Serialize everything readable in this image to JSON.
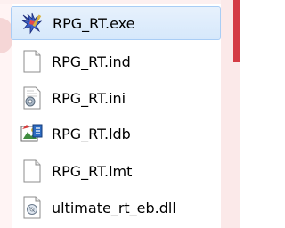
{
  "files": [
    {
      "name": "RPG_RT.exe",
      "icon": "exe-app-icon",
      "selected": true
    },
    {
      "name": "RPG_RT.ind",
      "icon": "blank-file-icon",
      "selected": false
    },
    {
      "name": "RPG_RT.ini",
      "icon": "settings-file-icon",
      "selected": false
    },
    {
      "name": "RPG_RT.ldb",
      "icon": "database-file-icon",
      "selected": false
    },
    {
      "name": "RPG_RT.lmt",
      "icon": "blank-file-icon",
      "selected": false
    },
    {
      "name": "ultimate_rt_eb.dll",
      "icon": "dll-file-icon",
      "selected": false
    }
  ],
  "colors": {
    "selection_bg": "#d9e9fb",
    "selection_border": "#a9cdf5",
    "text": "#000000"
  }
}
